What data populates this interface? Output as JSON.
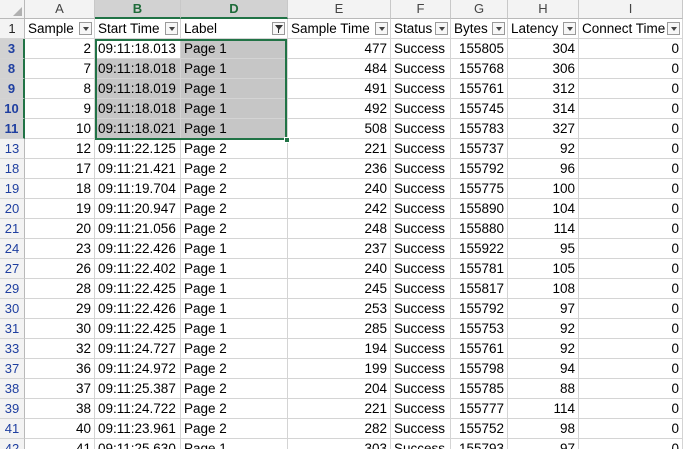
{
  "columns": [
    {
      "letter": "A",
      "header": "Sample",
      "filter": "dropdown",
      "align": "num"
    },
    {
      "letter": "B",
      "header": "Start Time",
      "filter": "dropdown",
      "align": "txt"
    },
    {
      "letter": "D",
      "header": "Label",
      "filter": "funnel",
      "align": "txt"
    },
    {
      "letter": "E",
      "header": "Sample Time",
      "filter": "dropdown",
      "align": "num"
    },
    {
      "letter": "F",
      "header": "Status",
      "filter": "dropdown",
      "align": "txt"
    },
    {
      "letter": "G",
      "header": "Bytes",
      "filter": "dropdown",
      "align": "num"
    },
    {
      "letter": "H",
      "header": "Latency",
      "filter": "dropdown",
      "align": "num"
    },
    {
      "letter": "I",
      "header": "Connect Time",
      "filter": "dropdown",
      "align": "num"
    }
  ],
  "header_row_number": "1",
  "selected_columns": [
    "B",
    "D"
  ],
  "selected_rows": [
    "3",
    "8",
    "9",
    "10",
    "11"
  ],
  "rows": [
    {
      "num": "3",
      "cells": [
        "2",
        "09:11:18.013",
        "Page 1",
        "477",
        "Success",
        "155805",
        "304",
        "0"
      ]
    },
    {
      "num": "8",
      "cells": [
        "7",
        "09:11:18.018",
        "Page 1",
        "484",
        "Success",
        "155768",
        "306",
        "0"
      ]
    },
    {
      "num": "9",
      "cells": [
        "8",
        "09:11:18.019",
        "Page 1",
        "491",
        "Success",
        "155761",
        "312",
        "0"
      ]
    },
    {
      "num": "10",
      "cells": [
        "9",
        "09:11:18.018",
        "Page 1",
        "492",
        "Success",
        "155745",
        "314",
        "0"
      ]
    },
    {
      "num": "11",
      "cells": [
        "10",
        "09:11:18.021",
        "Page 1",
        "508",
        "Success",
        "155783",
        "327",
        "0"
      ]
    },
    {
      "num": "13",
      "cells": [
        "12",
        "09:11:22.125",
        "Page 2",
        "221",
        "Success",
        "155737",
        "92",
        "0"
      ]
    },
    {
      "num": "18",
      "cells": [
        "17",
        "09:11:21.421",
        "Page 2",
        "236",
        "Success",
        "155792",
        "96",
        "0"
      ]
    },
    {
      "num": "19",
      "cells": [
        "18",
        "09:11:19.704",
        "Page 2",
        "240",
        "Success",
        "155775",
        "100",
        "0"
      ]
    },
    {
      "num": "20",
      "cells": [
        "19",
        "09:11:20.947",
        "Page 2",
        "242",
        "Success",
        "155890",
        "104",
        "0"
      ]
    },
    {
      "num": "21",
      "cells": [
        "20",
        "09:11:21.056",
        "Page 2",
        "248",
        "Success",
        "155880",
        "114",
        "0"
      ]
    },
    {
      "num": "24",
      "cells": [
        "23",
        "09:11:22.426",
        "Page 1",
        "237",
        "Success",
        "155922",
        "95",
        "0"
      ]
    },
    {
      "num": "27",
      "cells": [
        "26",
        "09:11:22.402",
        "Page 1",
        "240",
        "Success",
        "155781",
        "105",
        "0"
      ]
    },
    {
      "num": "29",
      "cells": [
        "28",
        "09:11:22.425",
        "Page 1",
        "245",
        "Success",
        "155817",
        "108",
        "0"
      ]
    },
    {
      "num": "30",
      "cells": [
        "29",
        "09:11:22.426",
        "Page 1",
        "253",
        "Success",
        "155792",
        "97",
        "0"
      ]
    },
    {
      "num": "31",
      "cells": [
        "30",
        "09:11:22.425",
        "Page 1",
        "285",
        "Success",
        "155753",
        "92",
        "0"
      ]
    },
    {
      "num": "33",
      "cells": [
        "32",
        "09:11:24.727",
        "Page 2",
        "194",
        "Success",
        "155761",
        "92",
        "0"
      ]
    },
    {
      "num": "37",
      "cells": [
        "36",
        "09:11:24.972",
        "Page 2",
        "199",
        "Success",
        "155798",
        "94",
        "0"
      ]
    },
    {
      "num": "38",
      "cells": [
        "37",
        "09:11:25.387",
        "Page 2",
        "204",
        "Success",
        "155785",
        "88",
        "0"
      ]
    },
    {
      "num": "39",
      "cells": [
        "38",
        "09:11:24.722",
        "Page 2",
        "221",
        "Success",
        "155777",
        "114",
        "0"
      ]
    },
    {
      "num": "41",
      "cells": [
        "40",
        "09:11:23.961",
        "Page 2",
        "282",
        "Success",
        "155752",
        "98",
        "0"
      ]
    },
    {
      "num": "42",
      "cells": [
        "41",
        "09:11:25.630",
        "Page 1",
        "303",
        "Success",
        "155793",
        "97",
        "0"
      ]
    }
  ]
}
